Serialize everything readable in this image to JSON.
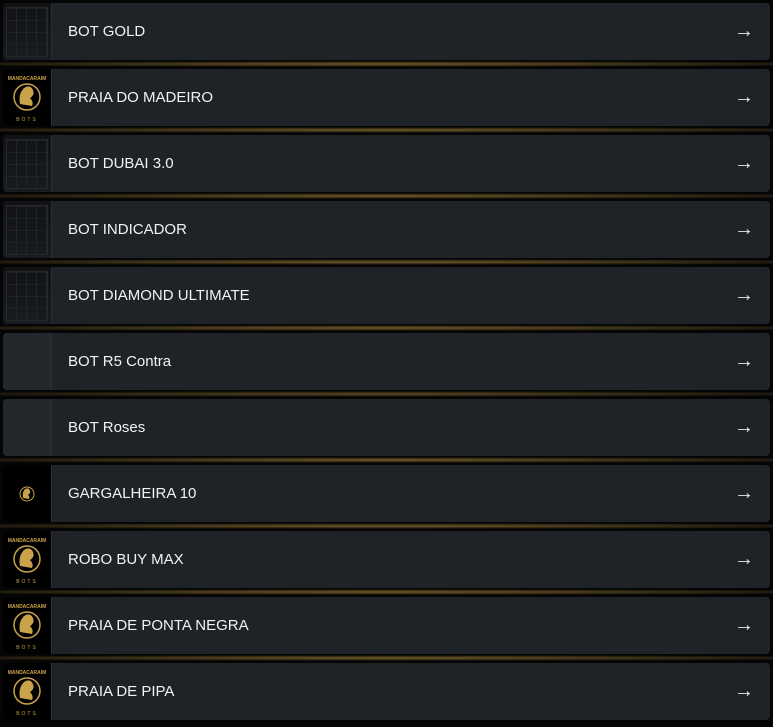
{
  "items": [
    {
      "label": "BOT GOLD",
      "thumb": "dark"
    },
    {
      "label": "PRAIA DO MADEIRO",
      "thumb": "logo"
    },
    {
      "label": "BOT DUBAI 3.0",
      "thumb": "dark"
    },
    {
      "label": "BOT INDICADOR",
      "thumb": "dark"
    },
    {
      "label": "BOT DIAMOND ULTIMATE",
      "thumb": "dark"
    },
    {
      "label": "BOT R5 Contra",
      "thumb": "blank"
    },
    {
      "label": "BOT Roses",
      "thumb": "blank"
    },
    {
      "label": "GARGALHEIRA 10",
      "thumb": "logo-small"
    },
    {
      "label": "ROBO BUY MAX",
      "thumb": "logo"
    },
    {
      "label": "PRAIA DE PONTA NEGRA",
      "thumb": "logo"
    },
    {
      "label": "PRAIA DE PIPA",
      "thumb": "logo"
    }
  ],
  "logo_text": {
    "top": "MANDACARAIM",
    "bottom": "BOTS"
  },
  "arrow_icon": "→",
  "colors": {
    "accent_gold": "#c9a24a",
    "row_bg": "#1f2227",
    "page_bg": "#050505"
  }
}
